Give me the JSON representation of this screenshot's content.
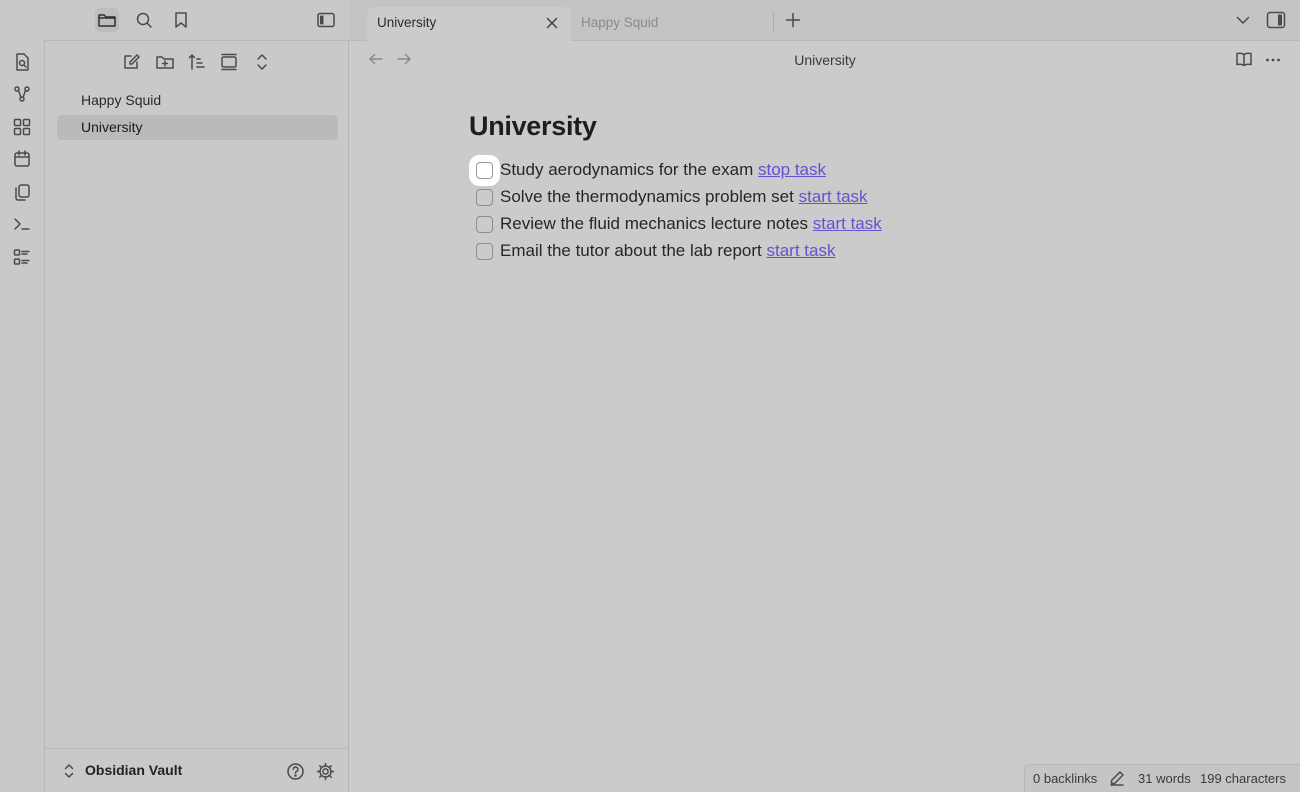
{
  "sidebar": {
    "top_icons": [
      "folder-icon",
      "search-icon",
      "bookmark-icon",
      "sidebar-toggle-icon"
    ],
    "explorer_tools": [
      "new-note-icon",
      "new-folder-icon",
      "sort-icon",
      "collapse-icon",
      "expand-icon"
    ],
    "files": [
      {
        "label": "Happy Squid"
      },
      {
        "label": "University"
      }
    ],
    "vault_name": "Obsidian Vault"
  },
  "ribbon": {
    "icons": [
      "file-search-icon",
      "graph-icon",
      "canvas-icon",
      "calendar-icon",
      "copy-icon",
      "terminal-icon",
      "list-icon"
    ]
  },
  "tabs": [
    {
      "label": "University",
      "active": true
    },
    {
      "label": "Happy Squid",
      "active": false
    }
  ],
  "editor": {
    "view_title": "University",
    "doc_title": "University",
    "tasks": [
      {
        "text": "Study aerodynamics for the exam",
        "link": "stop task",
        "checked": false
      },
      {
        "text": "Solve the thermodynamics problem set",
        "link": "start task",
        "checked": false
      },
      {
        "text": "Review the fluid mechanics lecture notes",
        "link": "start task",
        "checked": false
      },
      {
        "text": "Email the tutor about the lab report",
        "link": "start task",
        "checked": false
      }
    ]
  },
  "status": {
    "backlinks": "0 backlinks",
    "words": "31 words",
    "characters": "199 characters"
  },
  "colors": {
    "link": "#6a4fd0",
    "background": "#cbcbcb"
  }
}
